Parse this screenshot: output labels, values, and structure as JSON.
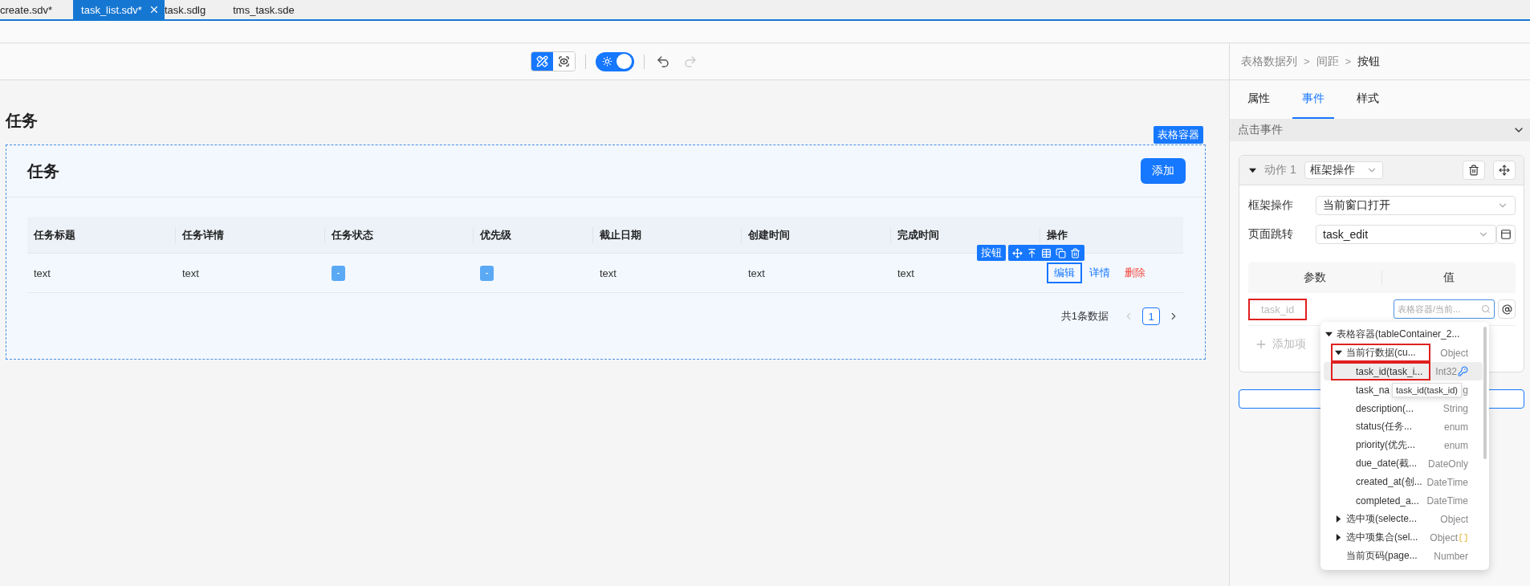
{
  "file_tabs": [
    {
      "label": "create.sdv*",
      "selected": false
    },
    {
      "label": "task_list.sdv*",
      "selected": true
    },
    {
      "label": "task.sdlg",
      "selected": false
    },
    {
      "label": "tms_task.sde",
      "selected": false
    }
  ],
  "toolbar": {
    "modes": [
      {
        "kind": "design",
        "selected": true
      },
      {
        "kind": "preview",
        "selected": false
      }
    ],
    "theme_toggle": {
      "on": true
    },
    "undo": {
      "disabled": false
    },
    "redo": {
      "disabled": true
    }
  },
  "page": {
    "title": "任务",
    "container_badge": "表格容器",
    "card_title": "任务",
    "add_button": "添加",
    "table": {
      "columns": [
        "任务标题",
        "任务详情",
        "任务状态",
        "优先级",
        "截止日期",
        "创建时间",
        "完成时间",
        "操作"
      ],
      "rows": [
        {
          "cells": [
            {
              "kind": "text",
              "text": "text"
            },
            {
              "kind": "text",
              "text": "text"
            },
            {
              "kind": "tag",
              "text": "-"
            },
            {
              "kind": "tag",
              "text": "-"
            },
            {
              "kind": "text",
              "text": "text"
            },
            {
              "kind": "text",
              "text": "text"
            },
            {
              "kind": "text",
              "text": "text"
            }
          ],
          "actions": [
            {
              "kind": "link",
              "label": "编辑",
              "selected": true
            },
            {
              "kind": "link",
              "label": "详情",
              "selected": false
            },
            {
              "kind": "danger",
              "label": "删除",
              "selected": false
            }
          ]
        }
      ]
    },
    "selection_toolbar": {
      "label": "按钮"
    },
    "pagination": {
      "total": "共1条数据",
      "pages": [
        {
          "label": "1",
          "selected": true
        }
      ],
      "prev_disabled": true,
      "next_disabled": false
    }
  },
  "panel": {
    "breadcrumb": {
      "items": [
        "表格数据列",
        "间距",
        "按钮"
      ],
      "separator": ">"
    },
    "tabs": [
      {
        "label": "属性",
        "selected": false
      },
      {
        "label": "事件",
        "selected": true
      },
      {
        "label": "样式",
        "selected": false
      }
    ],
    "section": {
      "title": "点击事件",
      "expanded": true
    },
    "action": {
      "label": "动作 1",
      "expanded": true,
      "type": "框架操作",
      "fields": [
        {
          "kind": "select",
          "label": "框架操作",
          "value": "当前窗口打开"
        },
        {
          "kind": "page",
          "label": "页面跳转",
          "value": "task_edit"
        }
      ],
      "params_header": [
        "参数",
        "值"
      ],
      "params": [
        {
          "name": "task_id",
          "highlighted": true,
          "placeholder": "表格容器/当前..."
        }
      ],
      "add_item": "添加项"
    },
    "tree": [
      {
        "label": "表格容器(tableContainer_2...",
        "expanded": true,
        "selected": false,
        "highlighted": false,
        "children": [
          {
            "label": "当前行数据(cu...",
            "type": "Object",
            "expanded": true,
            "selected": false,
            "highlighted": true,
            "children": [
              {
                "kind": "key",
                "label": "task_id(task_i...",
                "type": "Int32",
                "selected": true,
                "highlighted": true
              },
              {
                "label": "task_na",
                "type": "g",
                "selected": false,
                "highlighted": false
              },
              {
                "label": "description(...",
                "type": "String",
                "selected": false,
                "highlighted": false
              },
              {
                "label": "status(任务...",
                "type": "enum",
                "selected": false,
                "highlighted": false
              },
              {
                "label": "priority(优先...",
                "type": "enum",
                "selected": false,
                "highlighted": false
              },
              {
                "label": "due_date(截...",
                "type": "DateOnly",
                "selected": false,
                "highlighted": false
              },
              {
                "label": "created_at(创...",
                "type": "DateTime",
                "selected": false,
                "highlighted": false
              },
              {
                "label": "completed_a...",
                "type": "DateTime",
                "selected": false,
                "highlighted": false
              }
            ]
          },
          {
            "label": "选中项(selecte...",
            "type": "Object",
            "expanded": false,
            "selected": false,
            "highlighted": false
          },
          {
            "kind": "array",
            "label": "选中项集合(sel...",
            "type": "Object",
            "expanded": false,
            "selected": false,
            "highlighted": false
          },
          {
            "label": "当前页码(page...",
            "type": "Number",
            "selected": false,
            "highlighted": false
          }
        ]
      }
    ],
    "tooltip": "task_id(task_id)"
  }
}
